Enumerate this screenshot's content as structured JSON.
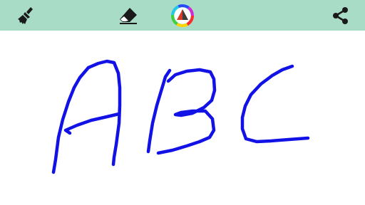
{
  "toolbar": {
    "background": "#a8dcc6",
    "tools": [
      {
        "name": "brush",
        "icon": "brush-icon"
      },
      {
        "name": "eraser",
        "icon": "eraser-icon"
      },
      {
        "name": "color-picker",
        "icon": "color-wheel-icon"
      },
      {
        "name": "share",
        "icon": "share-icon"
      }
    ]
  },
  "canvas": {
    "background": "#ffffff",
    "ink_color": "#1212e6",
    "drawn_text": "ABC"
  }
}
